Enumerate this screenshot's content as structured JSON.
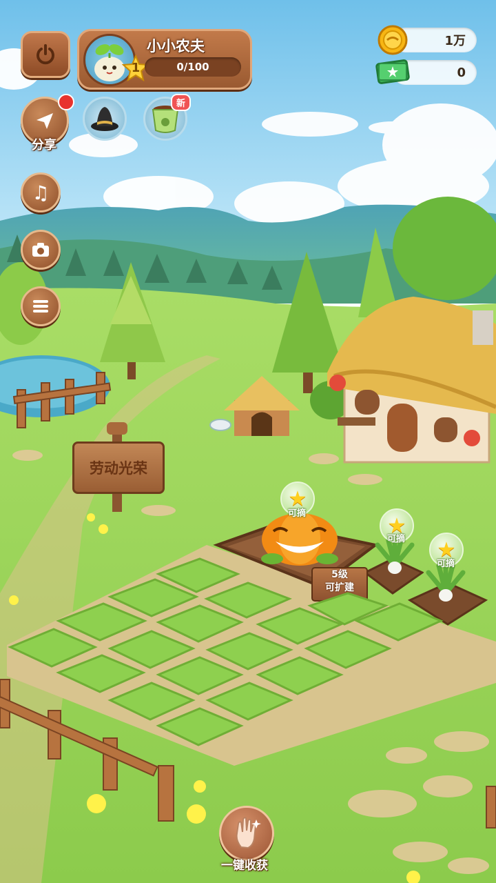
{
  "player": {
    "name": "小小农夫",
    "level": "1",
    "exp": "0/100"
  },
  "currency": {
    "coins": "1万",
    "cash": "0"
  },
  "left_menu": {
    "share_label": "分享"
  },
  "top_icons": {
    "new_badge": "新"
  },
  "sign": {
    "text": "劳动光荣"
  },
  "plots": {
    "pick_label_1": "可摘",
    "pick_label_2": "可摘",
    "pick_label_3": "可摘",
    "expand_level": "5级",
    "expand_label": "可扩建"
  },
  "bottom": {
    "harvest_all": "一键收获"
  },
  "colors": {
    "sky_top": "#7fc6ec",
    "grass": "#9fd65a",
    "wood": "#a0603a",
    "soil": "#8a5a3a"
  }
}
